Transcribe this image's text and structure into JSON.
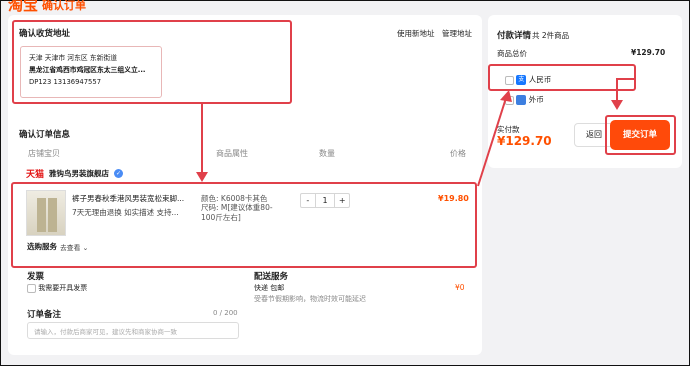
{
  "header": {
    "logo": "淘宝",
    "subtitle": "确认订单"
  },
  "address": {
    "title": "确认收货地址",
    "use_new": "使用新地址",
    "manage": "管理地址",
    "card": {
      "region": "天津 天津市 河东区 东新街道",
      "detail": "黑龙江省鸡西市鸡冠区东太三组义立...",
      "contact": "DP123  13136947557"
    }
  },
  "order": {
    "title": "确认订单信息",
    "columns": [
      "店铺宝贝",
      "商品属性",
      "数量",
      "价格"
    ],
    "shop": {
      "platform": "天猫",
      "name": "雅钩鸟男装旗舰店"
    },
    "item": {
      "name": "裤子男春秋季港风男装宽松束脚...",
      "service": "7天无理由退换  如实描述  支持...",
      "attr_color": "颜色: K6008卡其色",
      "attr_size": "尺码: M[建议体重80-100斤左右]",
      "quantity": "1",
      "minus": "-",
      "plus": "+",
      "price": "¥19.80"
    },
    "optional_service": "选购服务",
    "go_look": "去查看"
  },
  "invoice": {
    "title": "发票",
    "checkbox": "我需要开具发票"
  },
  "shipping": {
    "title": "配送服务",
    "method": "快递 包邮",
    "note": "受春节假期影响，物流时效可能延迟",
    "price": "¥0"
  },
  "remark": {
    "title": "订单备注",
    "count": "0 / 200",
    "placeholder": "请输入，付款后商家可见，建议先和商家协商一致"
  },
  "payment": {
    "title": "付款详情",
    "count": "共 2件商品",
    "total_label": "商品总价",
    "total_value": "¥129.70",
    "options": [
      {
        "label": "人民币",
        "icon": "alipay-icon",
        "icon_text": "支"
      },
      {
        "label": "外币",
        "icon": "foreign-currency-icon",
        "icon_text": ""
      }
    ],
    "actual_label": "实付款",
    "actual_value": "¥129.70",
    "back": "返回",
    "submit": "提交订单"
  },
  "colors": {
    "accent": "#ff5000",
    "highlight": "#e0404a",
    "tmall": "#e31414"
  }
}
